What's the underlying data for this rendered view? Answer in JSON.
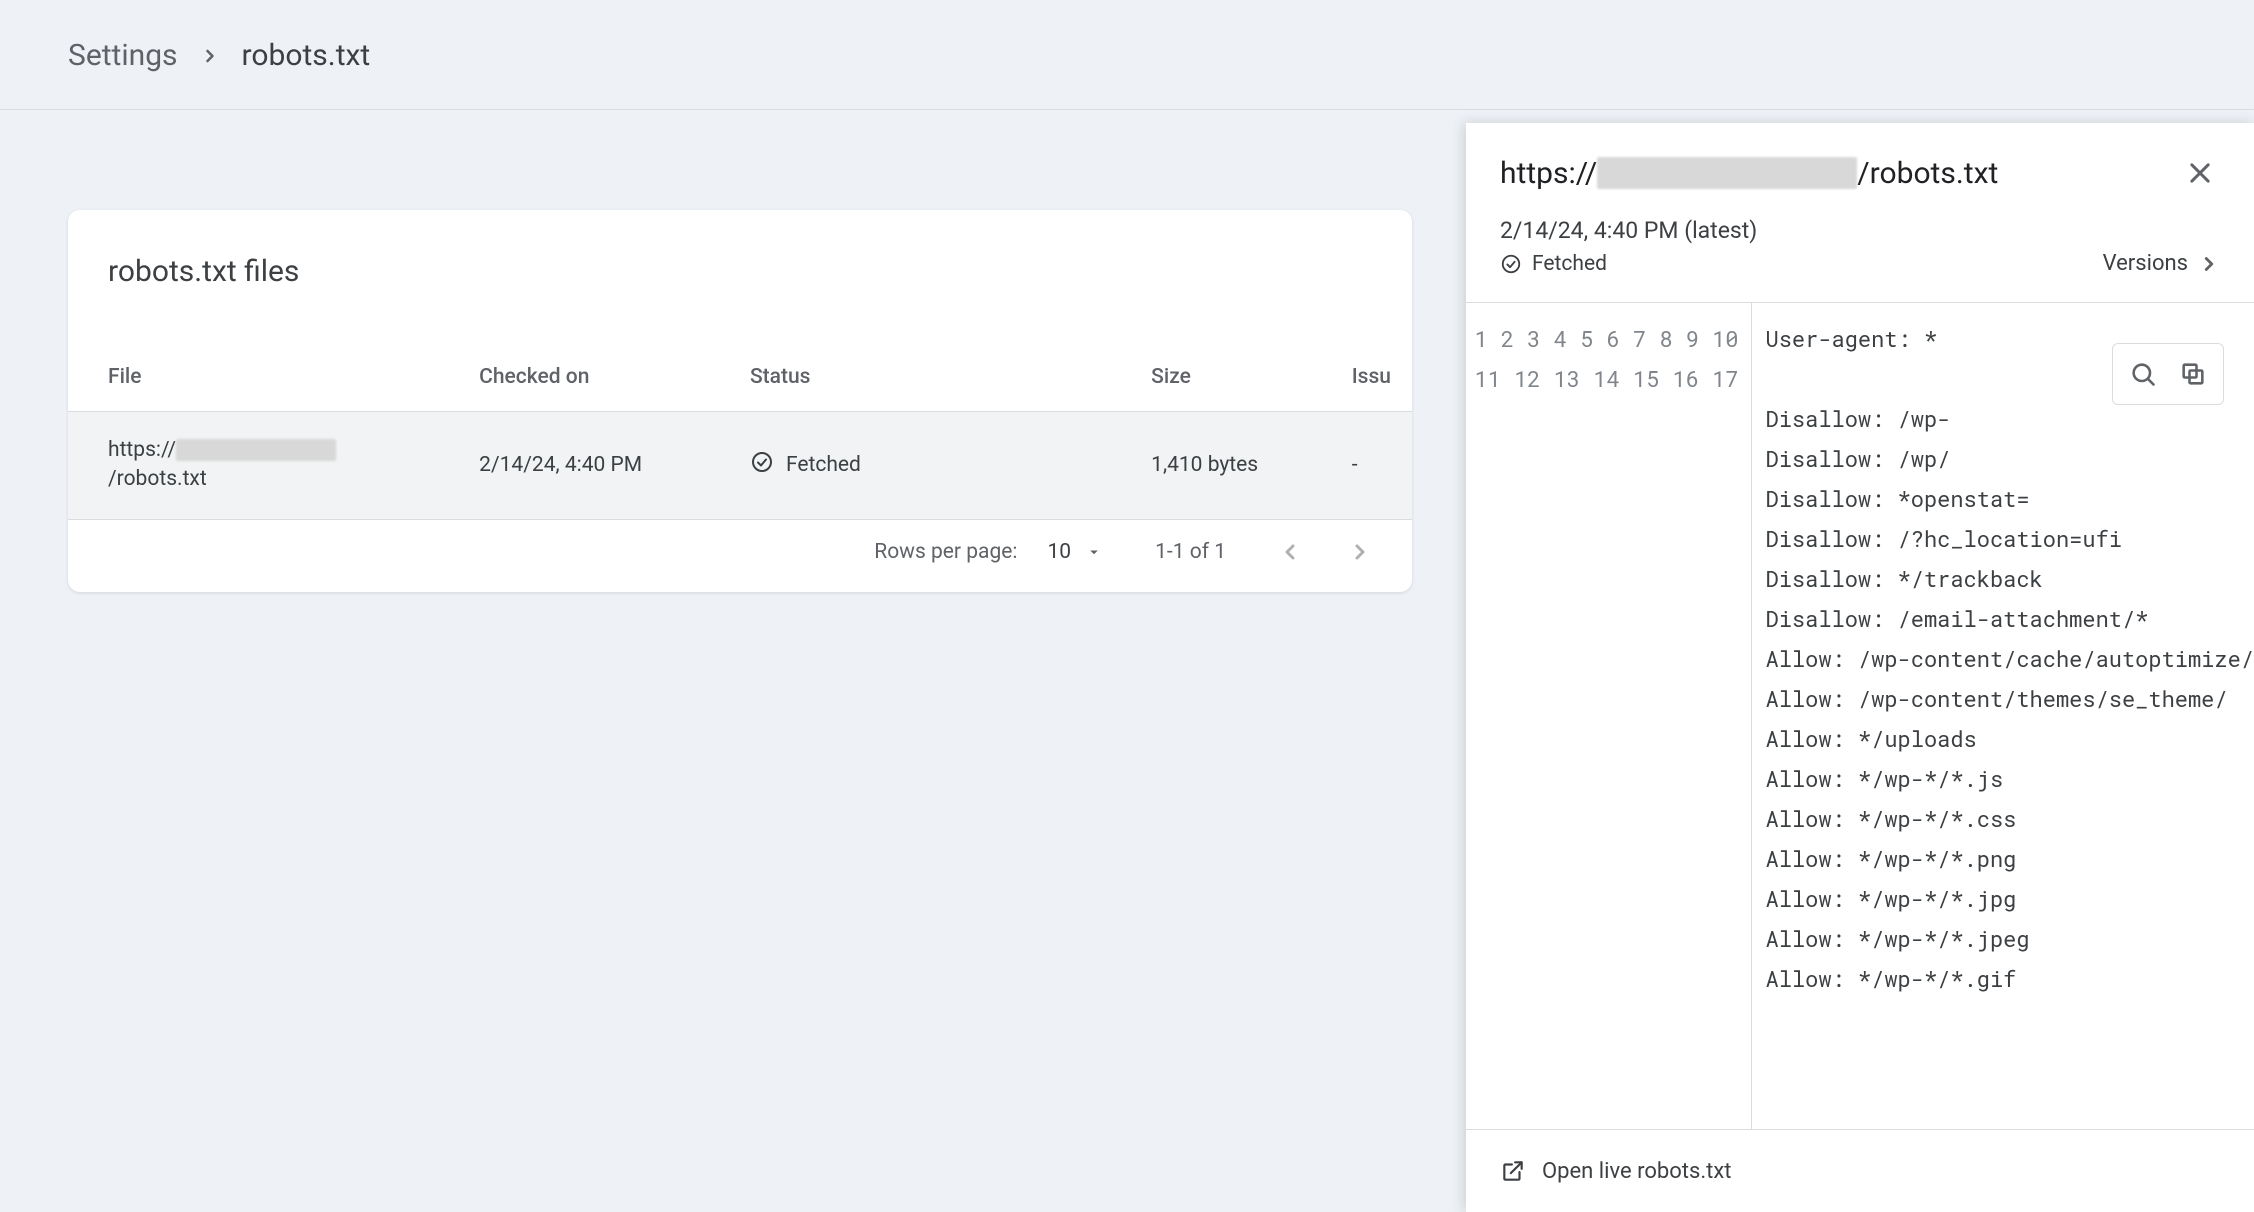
{
  "breadcrumb": {
    "root": "Settings",
    "current": "robots.txt"
  },
  "card": {
    "title": "robots.txt files"
  },
  "table": {
    "headers": {
      "file": "File",
      "checked": "Checked on",
      "status": "Status",
      "size": "Size",
      "issues": "Issu"
    },
    "rows": [
      {
        "file_prefix": "https://",
        "file_suffix": "/robots.txt",
        "checked": "2/14/24, 4:40 PM",
        "status": "Fetched",
        "size": "1,410 bytes",
        "issues": "-"
      }
    ]
  },
  "pager": {
    "rows_per_page_label": "Rows per page:",
    "rows_per_page_value": "10",
    "range": "1-1 of 1"
  },
  "sidepanel": {
    "title_prefix": "https://",
    "title_suffix": "/robots.txt",
    "meta_time": "2/14/24, 4:40 PM (latest)",
    "meta_status": "Fetched",
    "versions_label": "Versions",
    "code_lines": [
      "User-agent: *",
      "",
      "Disallow: /wp-",
      "Disallow: /wp/",
      "Disallow: *openstat=",
      "Disallow: /?hc_location=ufi",
      "Disallow: */trackback",
      "Disallow: /email-attachment/*",
      "Allow: /wp-content/cache/autoptimize/",
      "Allow: /wp-content/themes/se_theme/",
      "Allow: */uploads",
      "Allow: */wp-*/*.js",
      "Allow: */wp-*/*.css",
      "Allow: */wp-*/*.png",
      "Allow: */wp-*/*.jpg",
      "Allow: */wp-*/*.jpeg",
      "Allow: */wp-*/*.gif"
    ],
    "footer_label": "Open live robots.txt"
  }
}
